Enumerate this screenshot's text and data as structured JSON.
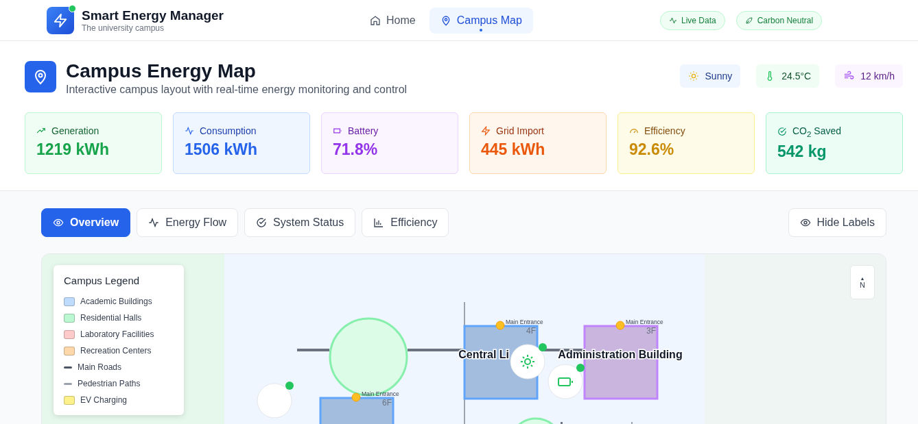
{
  "header": {
    "title": "Smart Energy Manager",
    "subtitle": "The university campus",
    "nav": [
      {
        "label": "Home",
        "kind": "home",
        "selected": false
      },
      {
        "label": "Campus Map",
        "kind": "pin",
        "selected": true
      }
    ],
    "badges": [
      {
        "label": "Live Data",
        "kind": "pulse"
      },
      {
        "label": "Carbon Neutral",
        "kind": "leaf"
      }
    ]
  },
  "page": {
    "title": "Campus Energy Map",
    "subtitle": "Interactive campus layout with real-time energy monitoring and control",
    "weather": [
      {
        "kind": "sun",
        "text": "Sunny"
      },
      {
        "kind": "temp",
        "text": "24.5°C"
      },
      {
        "kind": "wind",
        "text": "12 km/h"
      }
    ]
  },
  "stats": [
    {
      "kind": "generation",
      "label": "Generation",
      "value": "1219 kWh"
    },
    {
      "kind": "consumption",
      "label": "Consumption",
      "value": "1506 kWh"
    },
    {
      "kind": "battery",
      "label": "Battery",
      "value": "71.8%"
    },
    {
      "kind": "grid",
      "label": "Grid Import",
      "value": "445 kWh"
    },
    {
      "kind": "efficiency",
      "label": "Efficiency",
      "value": "92.6%"
    },
    {
      "kind": "co2",
      "label": "CO$_{2}$ Saved",
      "value": "542 kg"
    }
  ],
  "view_tabs": [
    {
      "label": "Overview",
      "kind": "eye",
      "selected": true
    },
    {
      "label": "Energy Flow",
      "kind": "pulse",
      "selected": false
    },
    {
      "label": "System Status",
      "kind": "check",
      "selected": false
    },
    {
      "label": "Efficiency",
      "kind": "bars",
      "selected": false
    }
  ],
  "labels_toggle": "Hide Labels",
  "map": {
    "legend": {
      "title": "Campus Legend",
      "items": [
        {
          "label": "Academic Buildings",
          "kind": "swatch",
          "color": "#bfdbfe"
        },
        {
          "label": "Residential Halls",
          "kind": "swatch",
          "color": "#bbf7d0"
        },
        {
          "label": "Laboratory Facilities",
          "kind": "swatch",
          "color": "#fecaca"
        },
        {
          "label": "Recreation Centers",
          "kind": "swatch",
          "color": "#fed7aa"
        },
        {
          "label": "Main Roads",
          "kind": "line",
          "color": "#4b5563"
        },
        {
          "label": "Pedestrian Paths",
          "kind": "line",
          "color": "#9ca3af"
        },
        {
          "label": "EV Charging",
          "kind": "swatch",
          "color": "#fef08a"
        }
      ]
    },
    "compass": {
      "arrow": "▲",
      "label": "N"
    },
    "buildings": [
      {
        "kind": "academic",
        "name": "Central Li",
        "floors": "4F",
        "entrance": "Main Entrance"
      },
      {
        "kind": "admin",
        "name": "Administration Building",
        "floors": "3F",
        "entrance": "Main Entrance"
      },
      {
        "kind": "academic",
        "floors": "6F",
        "entrance": "Main Entrance"
      }
    ],
    "nodes": [
      {
        "kind": "solar"
      },
      {
        "kind": "battery"
      },
      {
        "kind": "other"
      }
    ]
  }
}
